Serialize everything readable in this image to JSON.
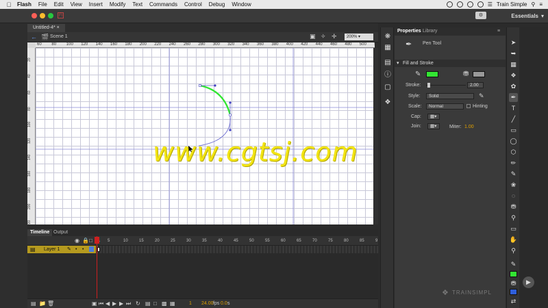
{
  "menubar": {
    "apple": "",
    "items": [
      "Flash",
      "File",
      "Edit",
      "View",
      "Insert",
      "Modify",
      "Text",
      "Commands",
      "Control",
      "Debug",
      "Window"
    ],
    "right_text": "Train Simple"
  },
  "apptop": {
    "workspace": "Essentials"
  },
  "document": {
    "tab": "Untitled-4*",
    "scene": "Scene 1",
    "zoom": "200%"
  },
  "ruler": {
    "top": [
      "60",
      "80",
      "100",
      "120",
      "140",
      "160",
      "180",
      "200",
      "220",
      "240",
      "260",
      "280",
      "300",
      "320",
      "340",
      "360",
      "380",
      "400",
      "420",
      "440",
      "460",
      "480",
      "500",
      "520"
    ],
    "left": [
      "20",
      "40",
      "60",
      "80",
      "100",
      "120",
      "140",
      "160",
      "180",
      "200",
      "220"
    ]
  },
  "stage": {
    "stroke_color": "#33e633",
    "path_color": "#6a6ad0"
  },
  "timeline": {
    "tabs": [
      "Timeline",
      "Output"
    ],
    "frames": [
      "1",
      "5",
      "10",
      "15",
      "20",
      "25",
      "30",
      "35",
      "40",
      "45",
      "50",
      "55",
      "60",
      "65",
      "70",
      "75",
      "80",
      "85",
      "9"
    ],
    "layer": "Layer 1",
    "footer": {
      "frame": "1",
      "fps": "24.00",
      "fps_unit": "fps",
      "time": "0.0",
      "time_unit": "s"
    }
  },
  "properties": {
    "tabs": [
      "Properties",
      "Library"
    ],
    "tool_name": "Pen Tool",
    "section": "Fill and Stroke",
    "stroke_color": "#33e633",
    "fill_color": "#999999",
    "stroke_label": "Stroke:",
    "stroke_value": "2.00",
    "style_label": "Style:",
    "style_value": "Solid",
    "scale_label": "Scale:",
    "scale_value": "Normal",
    "hinting_label": "Hinting",
    "cap_label": "Cap:",
    "join_label": "Join:",
    "miter_label": "Miter:",
    "miter_value": "1.00"
  },
  "tools_colors": {
    "stroke": "#33e633",
    "fill": "#2f5fdc"
  },
  "watermark": "www.cgtsj.com",
  "brand": "TRAINSIMPL"
}
